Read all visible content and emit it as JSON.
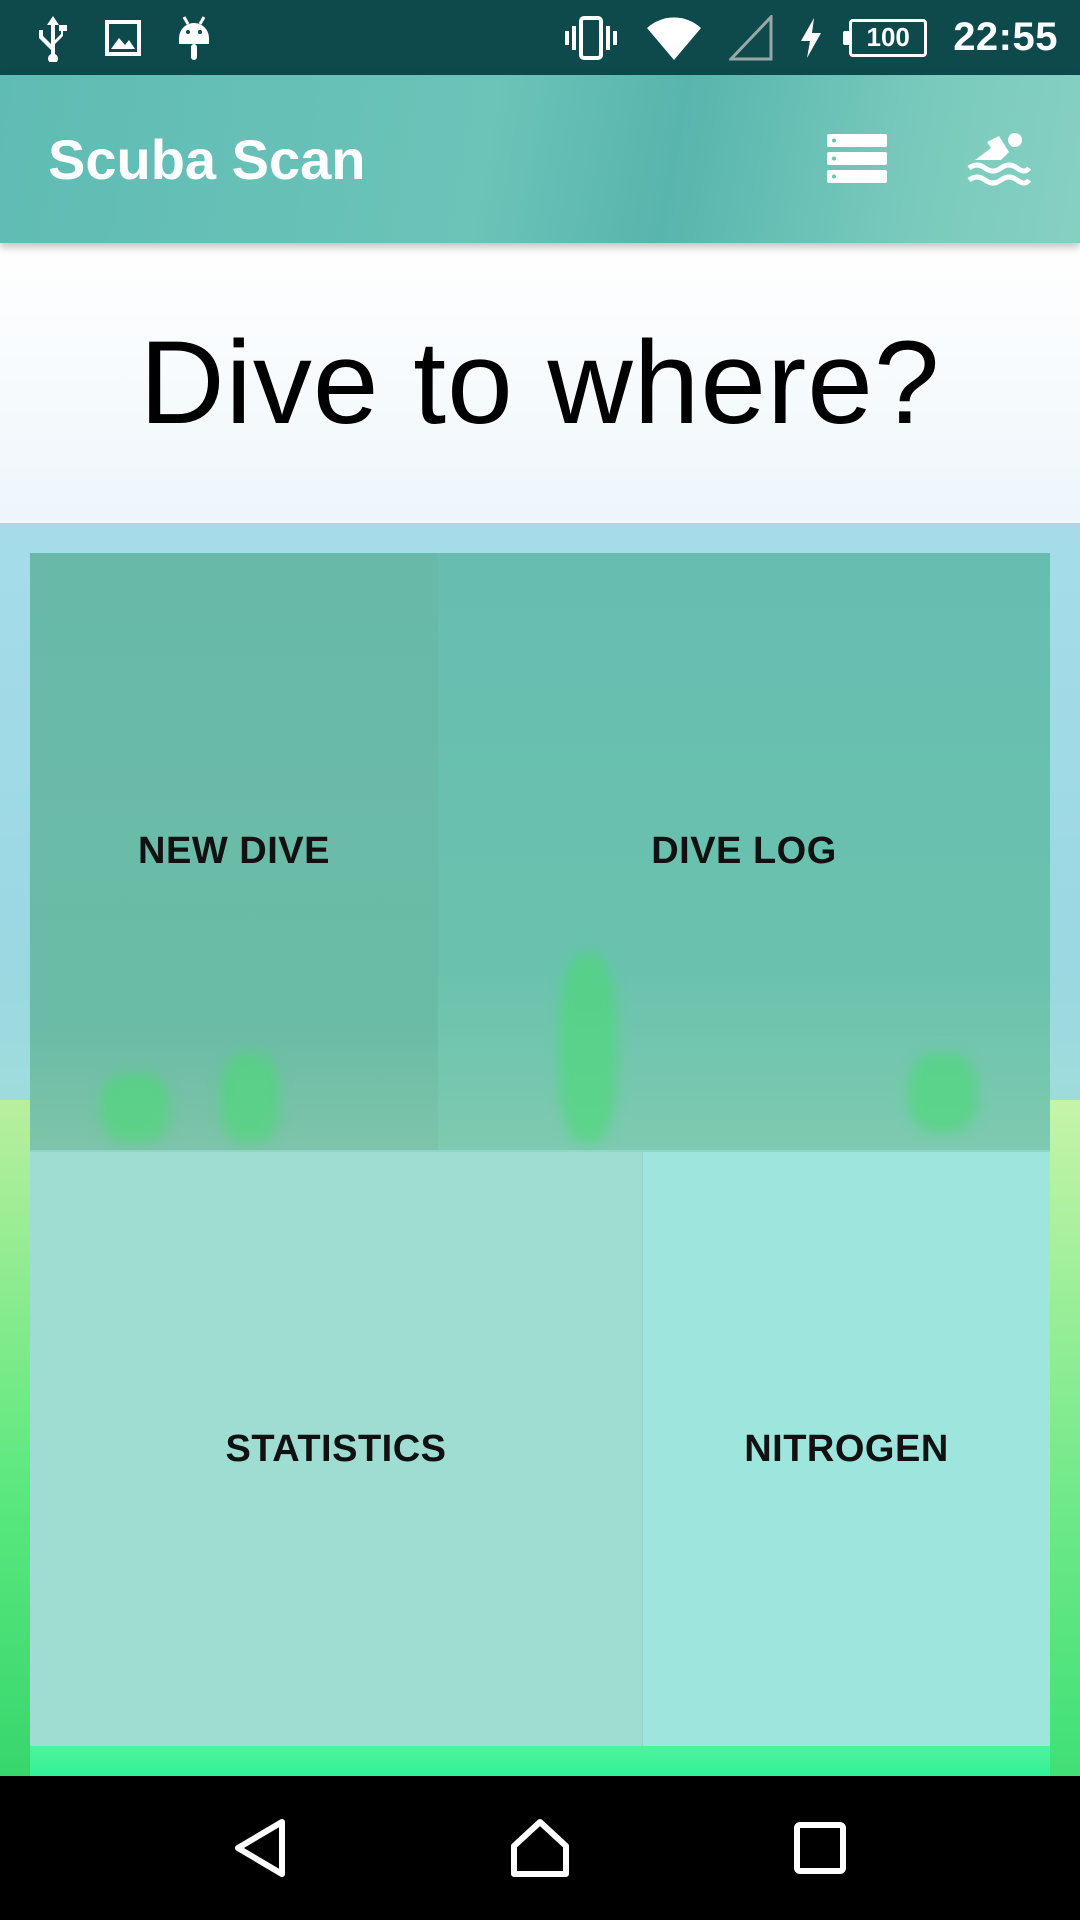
{
  "status_bar": {
    "battery_level": "100",
    "time": "22:55",
    "icons": [
      "usb-icon",
      "image-icon",
      "android-icon",
      "vibrate-icon",
      "wifi-icon",
      "cell-signal-icon",
      "charging-icon",
      "battery-icon"
    ]
  },
  "app_bar": {
    "title": "Scuba Scan",
    "actions": [
      "list-icon",
      "swimmer-icon"
    ]
  },
  "heading": "Dive to where?",
  "tiles": [
    {
      "label": "NEW DIVE",
      "color": "#6bbca6"
    },
    {
      "label": "DIVE LOG",
      "color": "#6ac2ae"
    },
    {
      "label": "STATISTICS",
      "color": "#9fddd2"
    },
    {
      "label": "NITROGEN",
      "color": "#9ee5de"
    }
  ],
  "nav_bar": {
    "buttons": [
      "back-icon",
      "home-icon",
      "recents-icon"
    ]
  },
  "colors": {
    "status_bar": "#0e4a4c",
    "app_bar": "#6cc3b8"
  }
}
